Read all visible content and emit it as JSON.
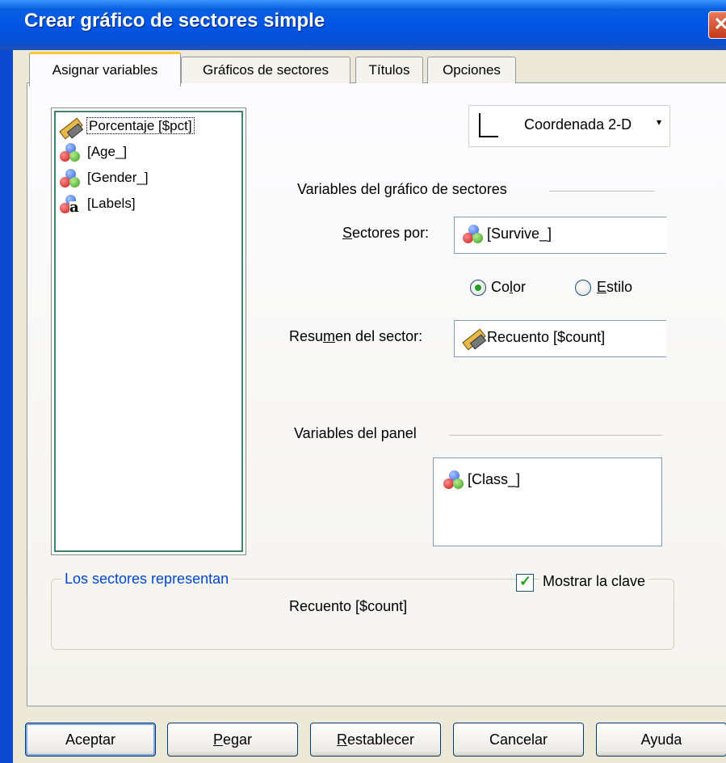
{
  "window": {
    "title": "Crear gráfico de sectores simple",
    "close_glyph": "✕"
  },
  "tabs": [
    {
      "label": "Asignar variables"
    },
    {
      "label": "Gráficos de sectores"
    },
    {
      "label": "Títulos"
    },
    {
      "label": "Opciones"
    }
  ],
  "variables": [
    {
      "label": "Porcentaje [$pct]",
      "icon": "scale-icon"
    },
    {
      "label": "[Age_]",
      "icon": "nominal-icon"
    },
    {
      "label": "[Gender_]",
      "icon": "nominal-icon"
    },
    {
      "label": "[Labels]",
      "icon": "nominal-string-icon"
    }
  ],
  "coordinate": {
    "label": "Coordenada 2-D",
    "arrow": "▾"
  },
  "pie_vars": {
    "section_label": "Variables del gráfico de sectores",
    "sectors_by_label_pre": "",
    "sectors_by_label_u": "S",
    "sectors_by_label_post": "ectores por:",
    "sectors_by_value": "[Survive_]",
    "radio_color_pre": "Co",
    "radio_color_u": "l",
    "radio_color_post": "or",
    "radio_style_u": "E",
    "radio_style_post": "stilo",
    "summary_label_pre": "Resu",
    "summary_label_u": "m",
    "summary_label_post": "en del sector:",
    "summary_value": "Recuento [$count]"
  },
  "panel_vars": {
    "section_label": "Variables del panel",
    "value": "[Class_]"
  },
  "group": {
    "title": "Los sectores representan",
    "checkbox_label": "Mostrar la clave",
    "checkbox_checked": true,
    "checkmark": "✓",
    "value": "Recuento [$count]"
  },
  "buttons": {
    "ok": "Aceptar",
    "paste_u": "P",
    "paste_post": "egar",
    "reset_u": "R",
    "reset_post": "establecer",
    "cancel": "Cancelar",
    "help": "Ayuda"
  }
}
